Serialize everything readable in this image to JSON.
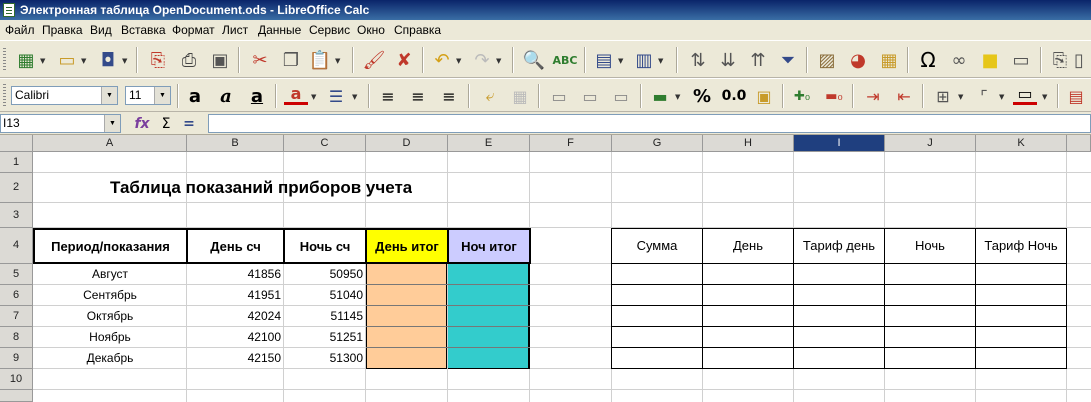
{
  "window": {
    "title": "Электронная таблица OpenDocument.ods - LibreOffice Calc"
  },
  "menu": [
    "Файл",
    "Правка",
    "Вид",
    "Вставка",
    "Формат",
    "Лист",
    "Данные",
    "Сервис",
    "Окно",
    "Справка"
  ],
  "toolbar": {
    "font_name": "Calibri",
    "font_size": "11",
    "percent_icon": "%",
    "decimal_icon": "0.0"
  },
  "formula_bar": {
    "name_box": "I13",
    "formula": ""
  },
  "columns": [
    "A",
    "B",
    "C",
    "D",
    "E",
    "F",
    "G",
    "H",
    "I",
    "J",
    "K"
  ],
  "selected_column": "I",
  "rows": [
    "1",
    "2",
    "3",
    "4",
    "5",
    "6",
    "7",
    "8",
    "9",
    "10"
  ],
  "sheet": {
    "title": "Таблица показаний приборов учета",
    "headers": [
      "Период/показания",
      "День сч",
      "Ночь сч",
      "День итог",
      "Ноч итог"
    ],
    "data": [
      {
        "period": "Август",
        "day": "41856",
        "night": "50950"
      },
      {
        "period": "Сентябрь",
        "day": "41951",
        "night": "51040"
      },
      {
        "period": "Октябрь",
        "day": "42024",
        "night": "51145"
      },
      {
        "period": "Ноябрь",
        "day": "42100",
        "night": "51251"
      },
      {
        "period": "Декабрь",
        "day": "42150",
        "night": "51300"
      }
    ],
    "right_headers": [
      "Сумма",
      "День",
      "Тариф день",
      "Ночь",
      "Тариф Ночь"
    ]
  },
  "colors": {
    "day_total_header": "#ffff00",
    "night_total_header": "#ccccff",
    "day_total_fill": "#ffcc99",
    "night_total_fill": "#33cccc",
    "selected_header": "#1f3f7f"
  },
  "icons": [
    "new-icon",
    "open-icon",
    "save-icon",
    "pdf-icon",
    "print-icon",
    "preview-icon",
    "cut-icon",
    "copy-icon",
    "paste-icon",
    "clone-icon",
    "clear-format-icon",
    "undo-icon",
    "redo-icon",
    "find-icon",
    "spellcheck-icon",
    "rows-icon",
    "columns-icon",
    "sort-icon",
    "sort-asc-icon",
    "sort-desc-icon",
    "filter-icon",
    "image-icon",
    "chart-icon",
    "pivot-icon",
    "special-char-icon",
    "hyperlink-icon",
    "comment-icon",
    "header-footer-icon",
    "freeze-icon",
    "split-icon",
    "bold-icon",
    "italic-icon",
    "underline-icon",
    "font-color-icon",
    "highlight-icon",
    "align-left-icon",
    "align-center-icon",
    "align-right-icon",
    "wrap-icon",
    "merge-icon",
    "align-top-icon",
    "align-middle-icon",
    "align-bottom-icon",
    "currency-icon",
    "percent-icon",
    "decimal-icon",
    "date-icon",
    "add-decimal-icon",
    "remove-decimal-icon",
    "indent-increase-icon",
    "indent-decrease-icon",
    "borders-icon",
    "border-style-icon",
    "border-color-icon",
    "conditional-icon",
    "function-wizard-icon",
    "sum-icon",
    "formula-icon"
  ]
}
